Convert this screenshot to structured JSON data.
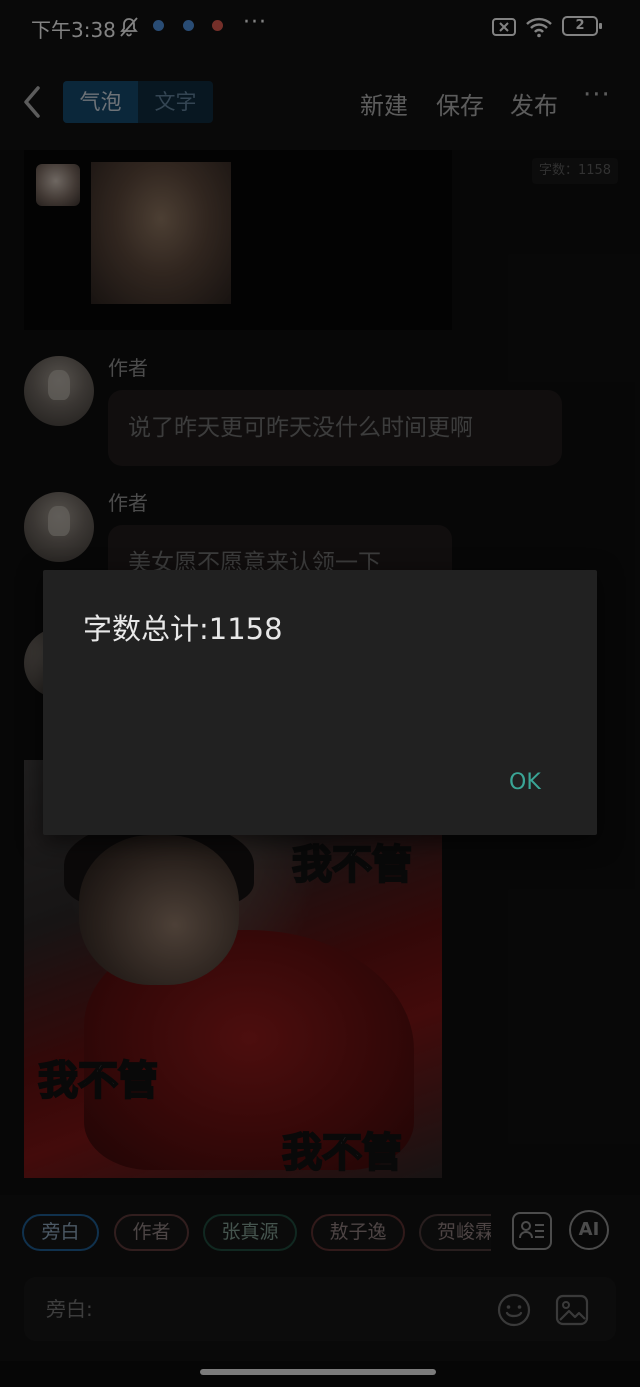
{
  "status_bar": {
    "time": "下午3:38",
    "more": "···",
    "battery": "2",
    "icons": [
      "bell-off-icon",
      "app-notification-icon",
      "app-notification-icon",
      "app-notification-icon",
      "sim-off-icon",
      "wifi-icon",
      "battery-icon"
    ]
  },
  "top_bar": {
    "tabs": [
      {
        "label": "气泡",
        "active": true
      },
      {
        "label": "文字",
        "active": false
      }
    ],
    "actions": {
      "new": "新建",
      "save": "保存",
      "publish": "发布"
    },
    "more": "···"
  },
  "chat": {
    "word_count_badge": "字数：1158",
    "messages": [
      {
        "sender": "作者",
        "text": "说了昨天更可昨天没什么时间更啊"
      },
      {
        "sender": "作者",
        "text": "美女愿不愿意来认领一下"
      }
    ],
    "meme_texts": [
      "我不管",
      "我不管",
      "我不管"
    ]
  },
  "characters": {
    "chips": [
      {
        "label": "旁白",
        "color": "#1e5a8c",
        "selected": true
      },
      {
        "label": "作者",
        "color": "#5a3838",
        "selected": false
      },
      {
        "label": "张真源",
        "color": "#1f4a3c",
        "selected": false
      },
      {
        "label": "敖子逸",
        "color": "#5a3030",
        "selected": false
      },
      {
        "label": "贺峻霖",
        "color": "#4a3838",
        "selected": false
      }
    ],
    "ai_label": "AI"
  },
  "input": {
    "label": "旁白:"
  },
  "dialog": {
    "message": "字数总计:1158",
    "ok": "OK"
  },
  "colors": {
    "accent": "#15476a",
    "ok": "#3aa596",
    "bubble": "#1f1a1a",
    "dialog_bg": "#212121"
  }
}
